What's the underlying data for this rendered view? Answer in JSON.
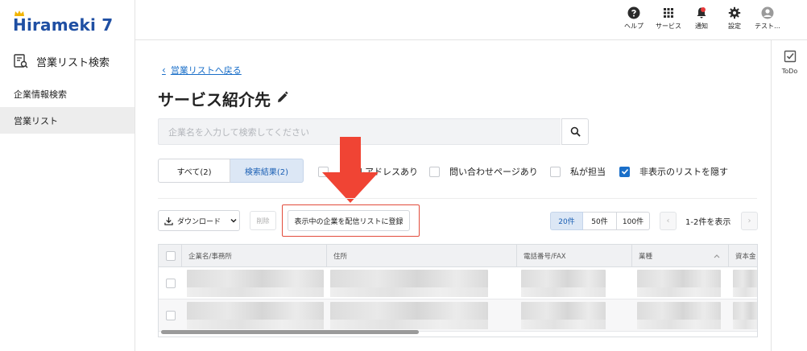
{
  "app": {
    "logo_text": "Hirameki 7"
  },
  "sidebar": {
    "title": "営業リスト検索",
    "items": [
      {
        "label": "企業情報検索"
      },
      {
        "label": "営業リスト"
      }
    ]
  },
  "header": {
    "items": [
      {
        "label": "ヘルプ",
        "icon": "help-icon"
      },
      {
        "label": "サービス",
        "icon": "grid-icon"
      },
      {
        "label": "通知",
        "icon": "bell-icon"
      },
      {
        "label": "設定",
        "icon": "gear-icon"
      },
      {
        "label": "テスト…",
        "icon": "user-icon"
      }
    ]
  },
  "rail": {
    "todo_label": "ToDo"
  },
  "main": {
    "back_link": "営業リストへ戻る",
    "page_title": "サービス紹介先",
    "search_placeholder": "企業名を入力して検索してください",
    "tabs": [
      {
        "label": "すべて(2)"
      },
      {
        "label": "検索結果(2)"
      }
    ],
    "filters": [
      {
        "label": "メールアドレスあり",
        "checked": false
      },
      {
        "label": "問い合わせページあり",
        "checked": false
      },
      {
        "label": "私が担当",
        "checked": false
      },
      {
        "label": "非表示のリストを隠す",
        "checked": true
      }
    ],
    "toolbar": {
      "download_label": "ダウンロード",
      "delete_label": "削除",
      "register_label": "表示中の企業を配信リストに登録"
    },
    "page_sizes": [
      "20件",
      "50件",
      "100件"
    ],
    "selected_page_size": "20件",
    "result_count": "1-2件を表示",
    "table": {
      "columns": [
        "企業名/事務所",
        "住所",
        "電話番号/FAX",
        "業種",
        "資本金"
      ],
      "row_count": 2
    }
  },
  "colors": {
    "accent": "#1a6fc9",
    "highlight": "#e24b3b",
    "notify_dot": "#e8393a"
  }
}
